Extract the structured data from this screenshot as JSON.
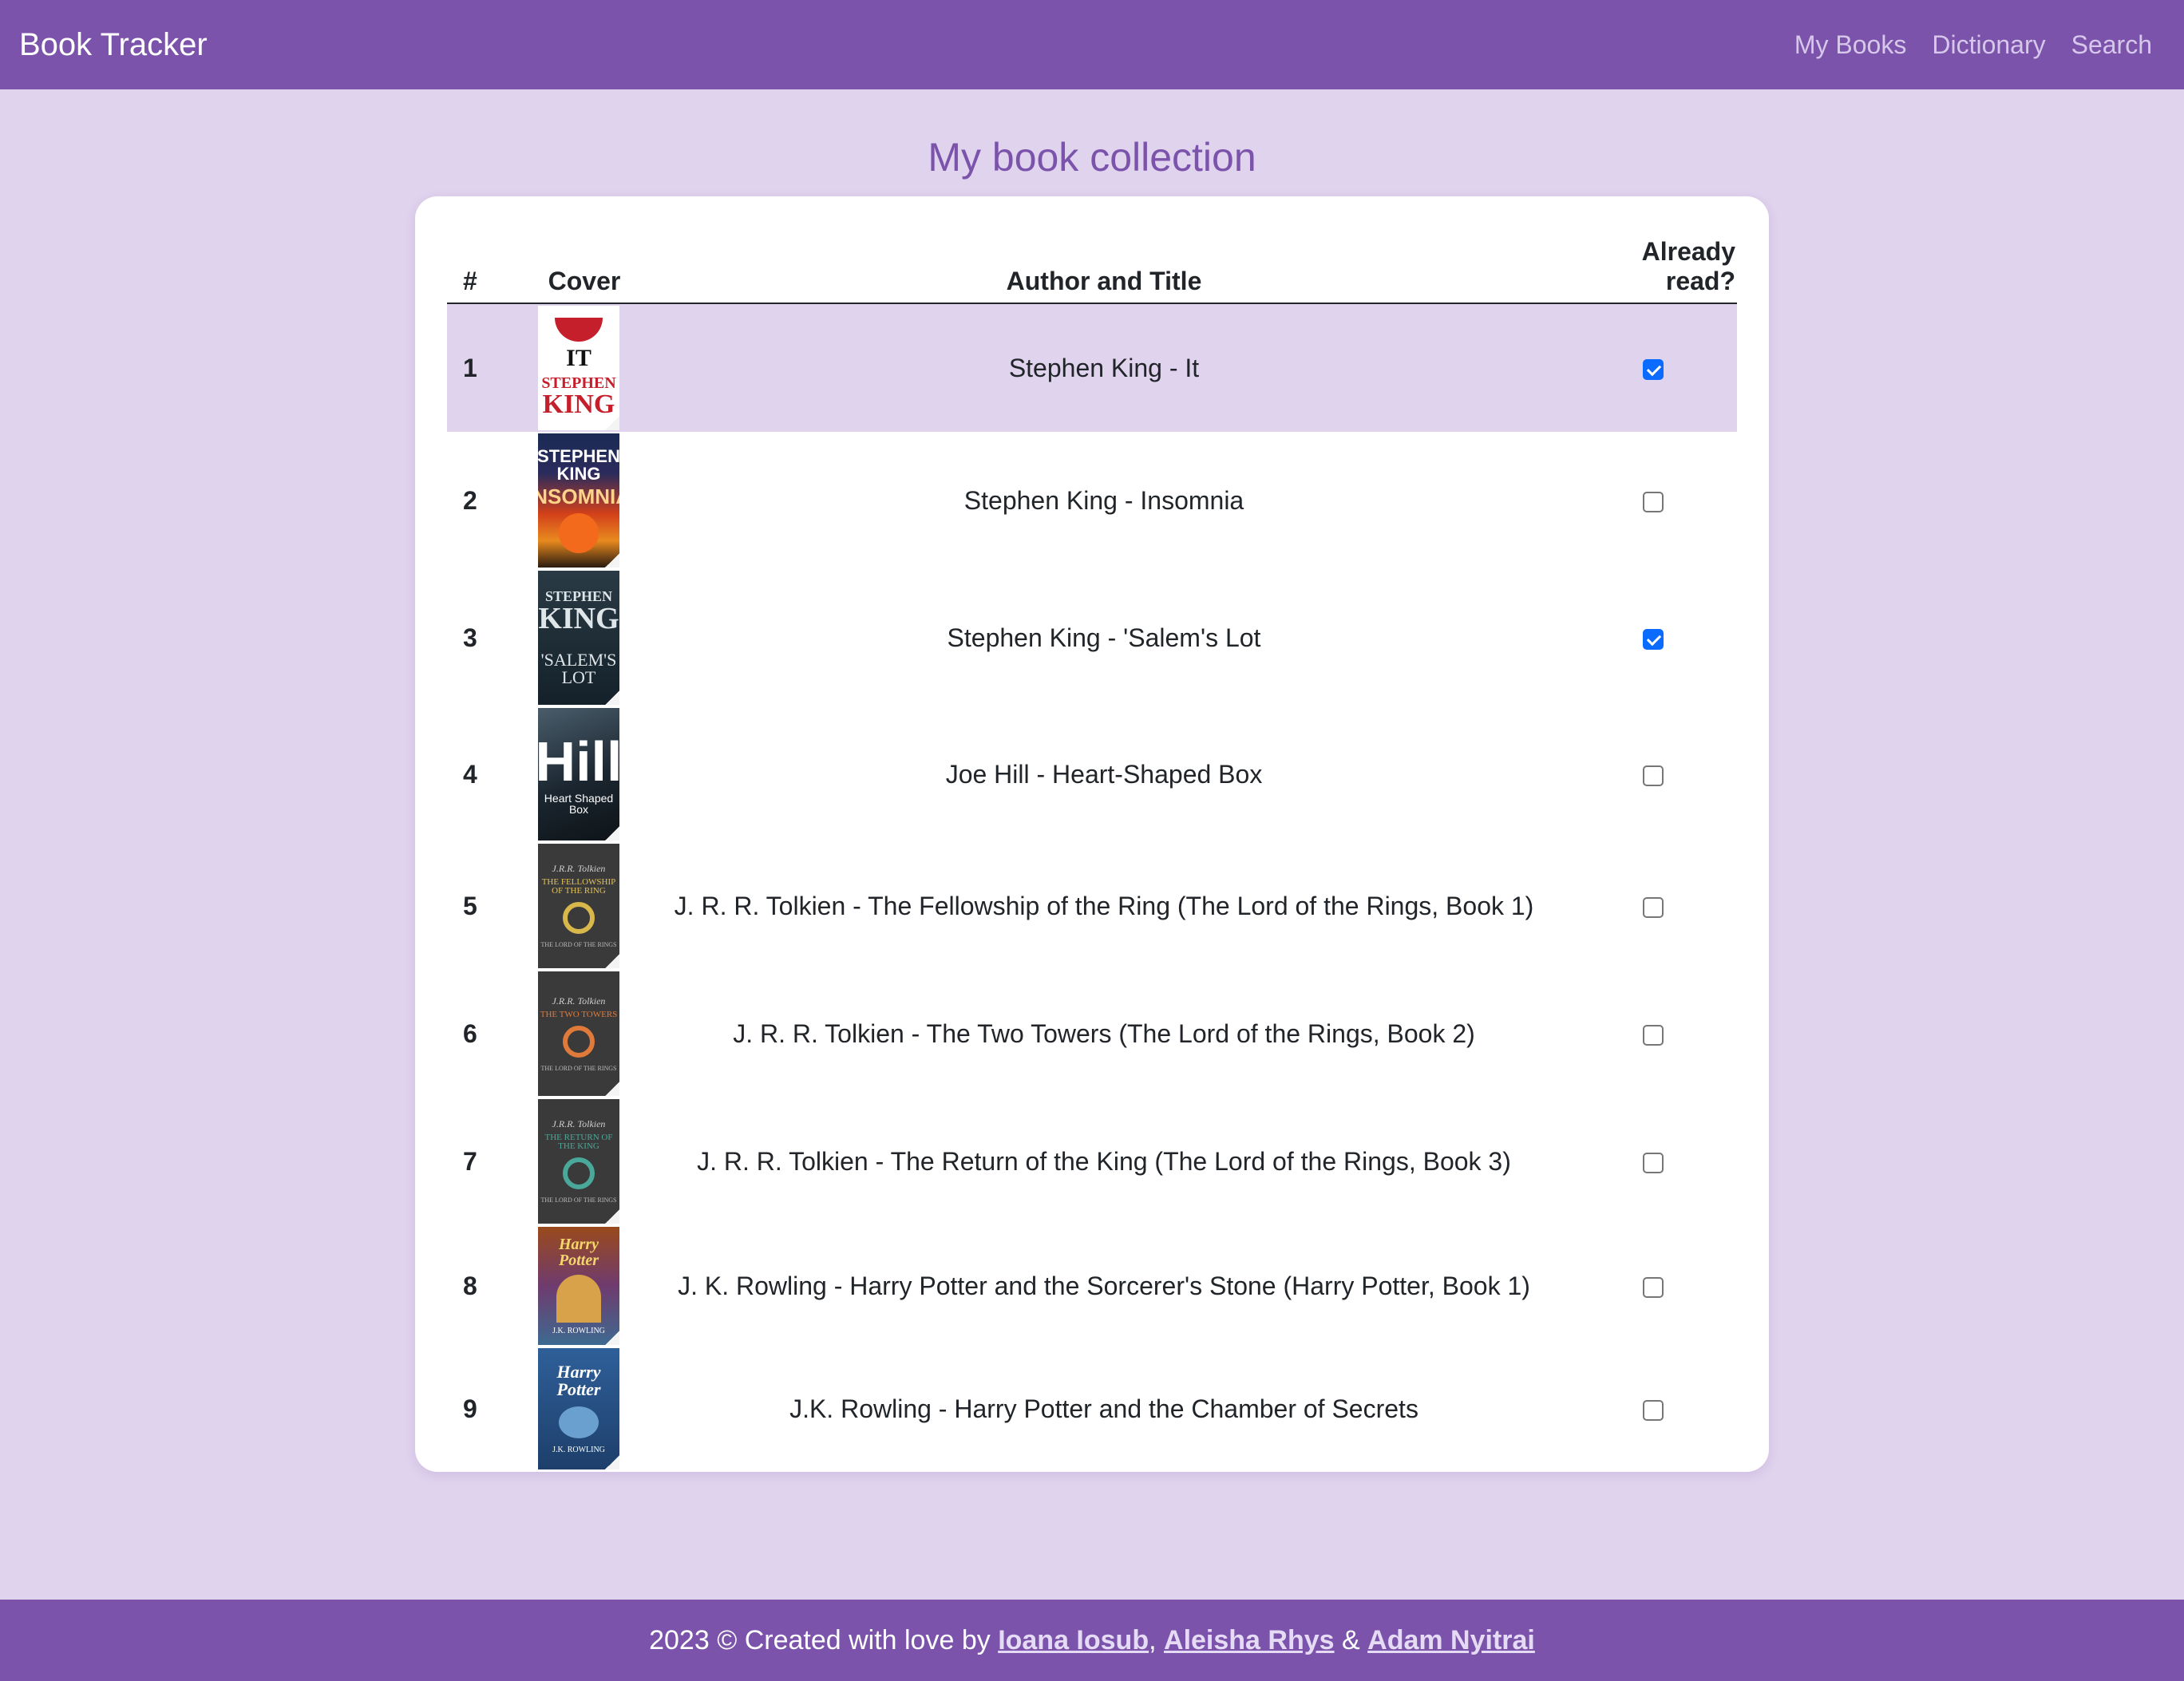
{
  "navbar": {
    "brand": "Book Tracker",
    "links": [
      "My Books",
      "Dictionary",
      "Search"
    ]
  },
  "page": {
    "title": "My book collection"
  },
  "table": {
    "headers": [
      "#",
      "Cover",
      "Author and Title",
      "Already read?"
    ],
    "rows": [
      {
        "num": "1",
        "title": "Stephen King - It",
        "read": true,
        "cover": {
          "lines": [
            "IT",
            "STEPHEN",
            "KING"
          ]
        }
      },
      {
        "num": "2",
        "title": "Stephen King - Insomnia",
        "read": false,
        "cover": {
          "lines": [
            "STEPHEN KING",
            "INSOMNIA"
          ]
        }
      },
      {
        "num": "3",
        "title": "Stephen King - 'Salem's Lot",
        "read": true,
        "cover": {
          "lines": [
            "STEPHEN",
            "KING",
            "'SALEM'S LOT"
          ]
        }
      },
      {
        "num": "4",
        "title": "Joe Hill - Heart-Shaped Box",
        "read": false,
        "cover": {
          "lines": [
            "Hill",
            "Heart Shaped Box"
          ]
        }
      },
      {
        "num": "5",
        "title": "J. R. R. Tolkien - The Fellowship of the Ring (The Lord of the Rings, Book 1)",
        "read": false,
        "cover": {
          "lines": [
            "J.R.R. Tolkien",
            "THE FELLOWSHIP OF THE RING",
            "THE LORD OF THE RINGS"
          ]
        }
      },
      {
        "num": "6",
        "title": "J. R. R. Tolkien - The Two Towers (The Lord of the Rings, Book 2)",
        "read": false,
        "cover": {
          "lines": [
            "J.R.R. Tolkien",
            "THE TWO TOWERS",
            "THE LORD OF THE RINGS"
          ]
        }
      },
      {
        "num": "7",
        "title": "J. R. R. Tolkien - The Return of the King (The Lord of the Rings, Book 3)",
        "read": false,
        "cover": {
          "lines": [
            "J.R.R. Tolkien",
            "THE RETURN OF THE KING",
            "THE LORD OF THE RINGS"
          ]
        }
      },
      {
        "num": "8",
        "title": "J. K. Rowling - Harry Potter and the Sorcerer's Stone (Harry Potter, Book 1)",
        "read": false,
        "cover": {
          "lines": [
            "Harry Potter",
            "J.K. ROWLING"
          ]
        }
      },
      {
        "num": "9",
        "title": "J.K. Rowling - Harry Potter and the Chamber of Secrets",
        "read": false,
        "cover": {
          "lines": [
            "Harry Potter",
            "J.K. ROWLING"
          ]
        }
      }
    ]
  },
  "footer": {
    "prefix": "2023 © Created with love by",
    "authors": [
      "Ioana Iosub",
      "Aleisha Rhys",
      "Adam Nyitrai"
    ],
    "sep1": ",",
    "sep2": "&"
  },
  "colors": {
    "primary": "#7b53ab",
    "background": "#e0d3ee",
    "card": "#ffffff",
    "checkbox_checked": "#0b6bff"
  }
}
